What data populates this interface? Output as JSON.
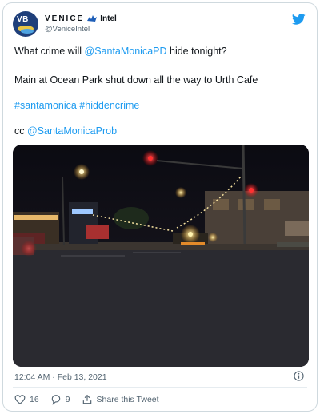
{
  "author": {
    "display_name": "VENICE",
    "display_name_suffix": "Intel",
    "handle": "@VeniceIntel",
    "avatar_text": "VB"
  },
  "tweet": {
    "line1": {
      "before": "What crime will ",
      "mention": "@SantaMonicaPD",
      "after": " hide tonight?"
    },
    "line2": "Main at Ocean Park shut down all the way to Urth Cafe",
    "hashtags": "#santamonica #hiddencrime",
    "cc_prefix": "cc ",
    "cc_mention": "@SantaMonicaProb"
  },
  "meta": {
    "timestamp": "12:04 AM · Feb 13, 2021"
  },
  "actions": {
    "likes": "16",
    "replies": "9",
    "share_label": "Share this Tweet"
  },
  "colors": {
    "link": "#1d9bf0",
    "text": "#0f1419",
    "muted": "#536471"
  }
}
